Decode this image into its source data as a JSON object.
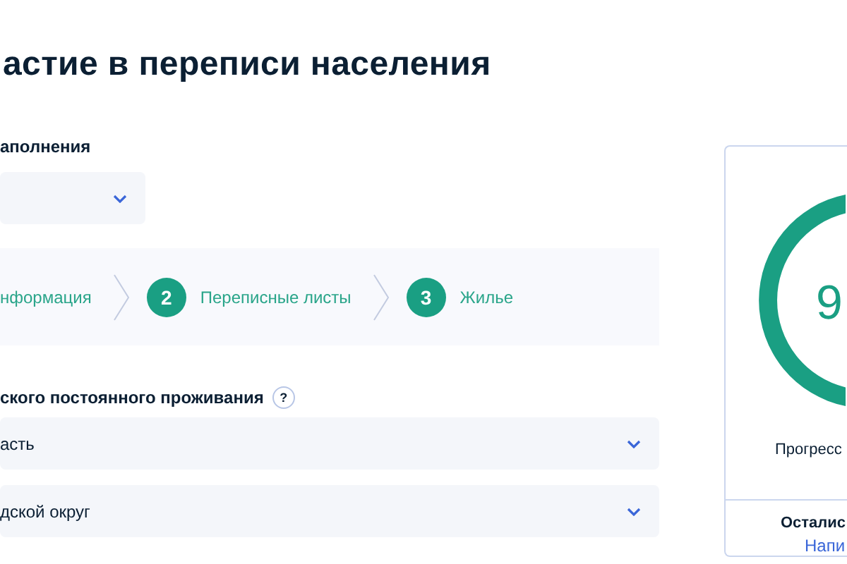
{
  "title": "астие в переписи населения",
  "fill_mode": {
    "label": "аполнения",
    "has_dropdown": true
  },
  "steps": [
    {
      "kind": "plain",
      "label": "нформация"
    },
    {
      "kind": "numbered",
      "number": "2",
      "label": "Переписные листы"
    },
    {
      "kind": "numbered",
      "number": "3",
      "label": "Жилье"
    }
  ],
  "residence": {
    "label": "ского постоянного проживания",
    "help": "?",
    "selects": [
      {
        "value": "асть"
      },
      {
        "value": "дской округ"
      }
    ]
  },
  "progress_card": {
    "value": "9",
    "caption": "Прогресс",
    "remaining_title": "Осталис",
    "remaining_link": "Напи"
  }
}
